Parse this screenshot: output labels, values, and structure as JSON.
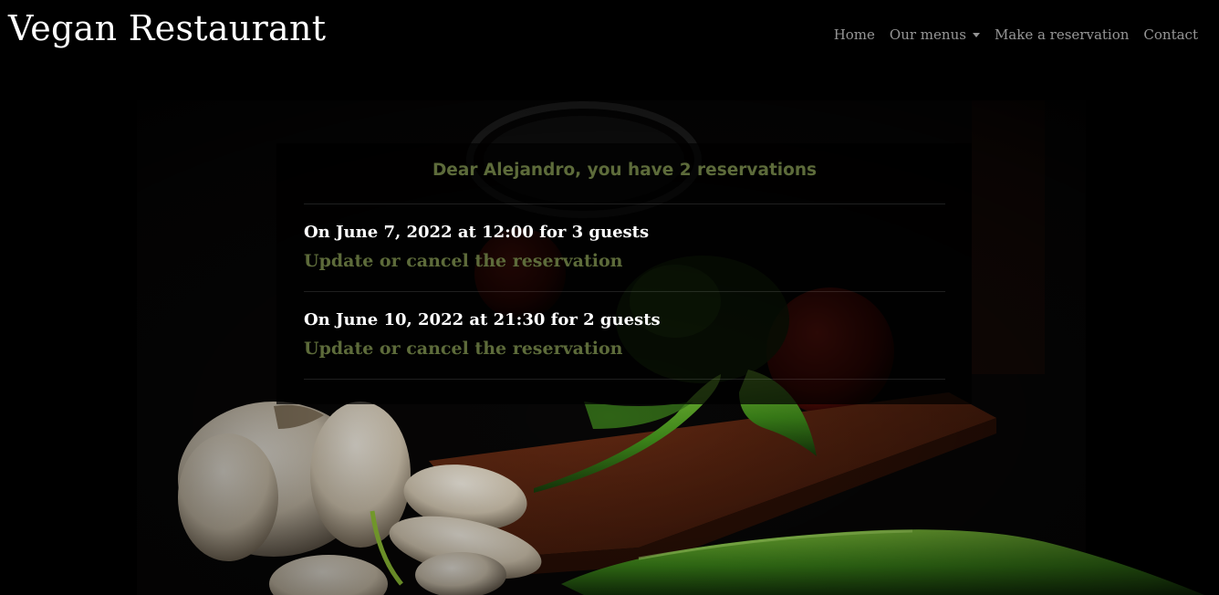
{
  "navbar": {
    "brand": "Vegan Restaurant",
    "links": {
      "home": "Home",
      "menus": "Our menus",
      "reservation": "Make a reservation",
      "contact": "Contact"
    }
  },
  "reservations": {
    "greeting": "Dear Alejandro, you have 2 reservations",
    "items": [
      {
        "date": "On June 7, 2022 at 12:00 for 3 guests",
        "link": "Update or cancel the reservation"
      },
      {
        "date": "On June 10, 2022 at 21:30 for 2 guests",
        "link": "Update or cancel the reservation"
      }
    ]
  },
  "colors": {
    "accent": "#5d6b3a",
    "background": "#000000",
    "text": "#ffffff"
  },
  "icons": {
    "menus_dropdown": "caret-down-icon"
  }
}
